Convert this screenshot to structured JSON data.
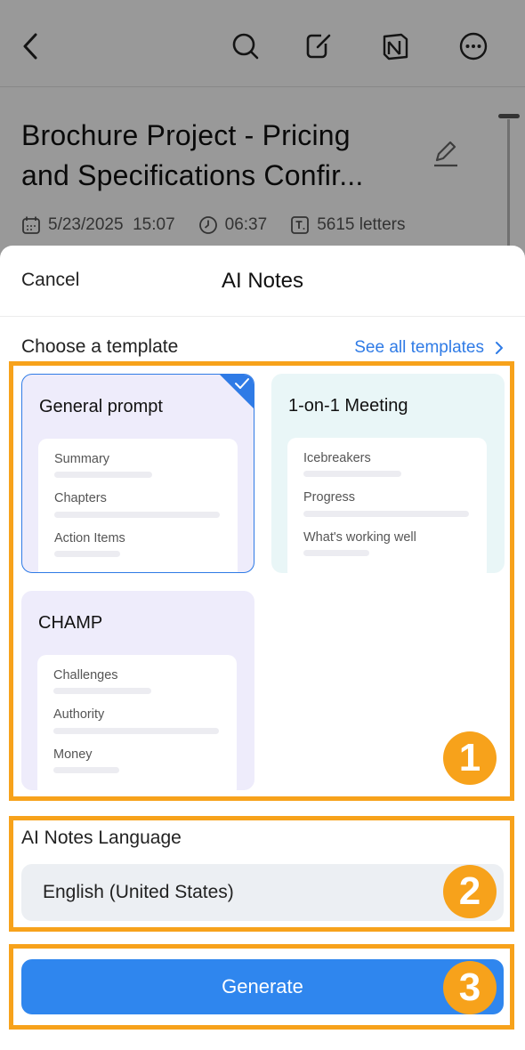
{
  "background_page": {
    "title": "Brochure Project - Pricing and Specifications Confir...",
    "meta": {
      "date": "5/23/2025",
      "time": "15:07",
      "duration": "06:37",
      "letters": "5615 letters"
    }
  },
  "sheet": {
    "cancel_label": "Cancel",
    "title": "AI Notes",
    "choose_label": "Choose a template",
    "see_all_label": "See all templates",
    "templates": [
      {
        "title": "General prompt",
        "rows": [
          "Summary",
          "Chapters",
          "Action Items"
        ],
        "selected": true
      },
      {
        "title": "1-on-1 Meeting",
        "rows": [
          "Icebreakers",
          "Progress",
          "What's working well"
        ],
        "selected": false
      },
      {
        "title": "CHAMP",
        "rows": [
          "Challenges",
          "Authority",
          "Money"
        ],
        "selected": false
      }
    ],
    "language_label": "AI Notes Language",
    "language_value": "English (United States)",
    "generate_label": "Generate"
  },
  "annotations": {
    "badge_1": "1",
    "badge_2": "2",
    "badge_3": "3",
    "highlight_color": "#f7a21b"
  },
  "colors": {
    "accent": "#2f86ee",
    "link": "#2f7be6",
    "card_purple": "#eeecfb",
    "card_teal": "#e9f6f7"
  }
}
